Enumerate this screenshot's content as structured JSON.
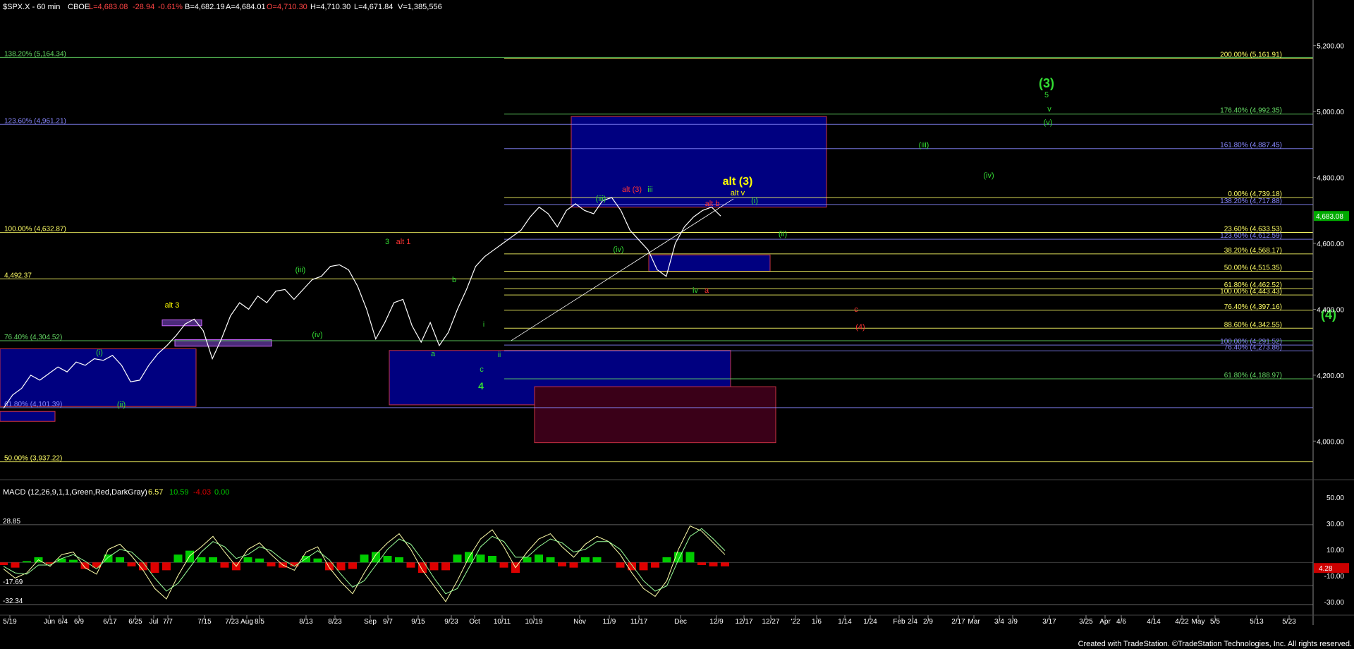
{
  "header": {
    "symbol": "$SPX.X - 60 min",
    "exchange": "CBOE",
    "last": "L=4,683.08",
    "change": "-28.94",
    "change_pct": "-0.61%",
    "bid": "B=4,682.19",
    "ask": "A=4,684.01",
    "open": "O=4,710.30",
    "high": "H=4,710.30",
    "low": "L=4,671.84",
    "volume": "V=1,385,556"
  },
  "footer": {
    "credit": "Created with TradeStation. ©TradeStation Technologies, Inc. All rights reserved."
  },
  "colors": {
    "background": "#000000",
    "grid": "#555555",
    "price": "#ffffff",
    "fib_yellow": "#ffff66",
    "fib_blue": "#8888ff",
    "fib_green": "#66dd66",
    "label_green": "#33dd33",
    "label_red": "#ff3333",
    "label_yellow": "#ffff00",
    "box_blue": "#000080",
    "box_maroon": "#3a0018",
    "macd_pos": "#00cc00",
    "macd_neg": "#dd0000"
  },
  "chart_data": [
    {
      "type": "line",
      "title": "$SPX.X - 60 min",
      "ylim": [
        3900,
        5300
      ],
      "y_ticks": [
        "5,200.00",
        "5,000.00",
        "4,800.00",
        "4,600.00",
        "4,400.00",
        "4,200.00",
        "4,000.00"
      ],
      "y_tick_values": [
        5200,
        5000,
        4800,
        4600,
        4400,
        4200,
        4000
      ],
      "last_price_label": "4,683.08",
      "last_price": 4683.08,
      "x_ticks": [
        "5/19",
        "Jun",
        "6/4",
        "6/9",
        "6/17",
        "6/25",
        "Jul",
        "7/7",
        "7/15",
        "7/23",
        "Aug",
        "8/5",
        "8/13",
        "8/23",
        "Sep",
        "9/7",
        "9/15",
        "9/23",
        "Oct",
        "10/11",
        "10/19",
        "Nov",
        "11/9",
        "11/17",
        "Dec",
        "12/9",
        "12/17",
        "12/27",
        "'22",
        "1/6",
        "1/14",
        "1/24",
        "Feb",
        "2/4",
        "2/9",
        "2/17",
        "Mar",
        "3/4",
        "3/9",
        "3/17",
        "3/25",
        "Apr",
        "4/6",
        "4/14",
        "4/22",
        "May",
        "5/5",
        "5/13",
        "5/23"
      ],
      "series": [
        {
          "values": [
            4100,
            4140,
            4160,
            4200,
            4185,
            4205,
            4225,
            4210,
            4240,
            4230,
            4250,
            4245,
            4260,
            4230,
            4180,
            4185,
            4230,
            4265,
            4290,
            4320,
            4355,
            4370,
            4335,
            4250,
            4310,
            4380,
            4420,
            4400,
            4440,
            4420,
            4455,
            4460,
            4430,
            4460,
            4490,
            4500,
            4530,
            4535,
            4520,
            4470,
            4400,
            4310,
            4360,
            4420,
            4430,
            4350,
            4300,
            4360,
            4290,
            4330,
            4400,
            4460,
            4530,
            4560,
            4580,
            4600,
            4620,
            4640,
            4680,
            4710,
            4690,
            4650,
            4700,
            4720,
            4700,
            4690,
            4730,
            4739,
            4700,
            4640,
            4610,
            4580,
            4520,
            4500,
            4600,
            4650,
            4680,
            4700,
            4710,
            4683
          ]
        }
      ],
      "fib_levels": [
        {
          "label": "138.20% (5,164.34)",
          "value": 5164.34,
          "side": "left",
          "color": "fib_green"
        },
        {
          "label": "200.00% (5,161.91)",
          "value": 5161.91,
          "side": "right",
          "color": "fib_yellow"
        },
        {
          "label": "176.40% (4,992.35)",
          "value": 4992.35,
          "side": "right",
          "color": "fib_green"
        },
        {
          "label": "123.60% (4,961.21)",
          "value": 4961.21,
          "side": "left",
          "color": "fib_blue"
        },
        {
          "label": "161.80% (4,887.45)",
          "value": 4887.45,
          "side": "right",
          "color": "fib_blue"
        },
        {
          "label": "0.00% (4,739.18)",
          "value": 4739.18,
          "side": "right",
          "color": "fib_yellow"
        },
        {
          "label": "138.20% (4,717.88)",
          "value": 4717.88,
          "side": "right",
          "color": "fib_blue"
        },
        {
          "label": "100.00% (4,632.87)",
          "value": 4632.87,
          "side": "left",
          "color": "fib_yellow"
        },
        {
          "label": "23.60% (4,633.53)",
          "value": 4633.53,
          "side": "right",
          "color": "fib_yellow"
        },
        {
          "label": "123.60% (4,612.59)",
          "value": 4612.59,
          "side": "right",
          "color": "fib_blue"
        },
        {
          "label": "38.20% (4,568.17)",
          "value": 4568.17,
          "side": "right",
          "color": "fib_yellow"
        },
        {
          "label": "50.00% (4,515.35)",
          "value": 4515.35,
          "side": "right",
          "color": "fib_yellow"
        },
        {
          "label": "4,492.37",
          "value": 4492.37,
          "side": "left",
          "color": "fib_yellow"
        },
        {
          "label": "61.80% (4,462.52)",
          "value": 4462.52,
          "side": "right",
          "color": "fib_yellow"
        },
        {
          "label": "100.00% (4,443.43)",
          "value": 4443.43,
          "side": "right",
          "color": "fib_yellow"
        },
        {
          "label": "76.40% (4,397.16)",
          "value": 4397.16,
          "side": "right",
          "color": "fib_yellow"
        },
        {
          "label": "88.60% (4,342.55)",
          "value": 4342.55,
          "side": "right",
          "color": "fib_yellow"
        },
        {
          "label": "76.40% (4,304.52)",
          "value": 4304.52,
          "side": "left",
          "color": "fib_green"
        },
        {
          "label": "100.00% (4,291.52)",
          "value": 4291.52,
          "side": "right",
          "color": "fib_blue"
        },
        {
          "label": "76.40% (4,273.86)",
          "value": 4273.86,
          "side": "right",
          "color": "fib_blue"
        },
        {
          "label": "61.80% (4,188.97)",
          "value": 4188.97,
          "side": "right",
          "color": "fib_green"
        },
        {
          "label": "61.80% (4,101.39)",
          "value": 4101.39,
          "side": "left",
          "color": "fib_blue"
        },
        {
          "label": "50.00% (3,937.22)",
          "value": 3937.22,
          "side": "left",
          "color": "fib_yellow"
        }
      ],
      "wave_labels": [
        {
          "text": "(3)",
          "color": "label_green"
        },
        {
          "text": "5",
          "color": "label_green"
        },
        {
          "text": "v",
          "color": "label_green"
        },
        {
          "text": "(v)",
          "color": "label_green"
        },
        {
          "text": "(iii)",
          "color": "label_green"
        },
        {
          "text": "(iv)",
          "color": "label_green"
        },
        {
          "text": "alt (3)",
          "color": "label_yellow"
        },
        {
          "text": "alt v",
          "color": "label_yellow"
        },
        {
          "text": "(i)",
          "color": "label_green"
        },
        {
          "text": "(ii)",
          "color": "label_green"
        },
        {
          "text": "(iii)",
          "color": "label_green"
        },
        {
          "text": "alt (3)",
          "color": "label_red"
        },
        {
          "text": "iii",
          "color": "label_green"
        },
        {
          "text": "alt b",
          "color": "label_red"
        },
        {
          "text": "(iv)",
          "color": "label_green"
        },
        {
          "text": "iv",
          "color": "label_green"
        },
        {
          "text": "a",
          "color": "label_red"
        },
        {
          "text": "c",
          "color": "label_red"
        },
        {
          "text": "(4)",
          "color": "label_red"
        },
        {
          "text": "(4)",
          "color": "label_green"
        },
        {
          "text": "3",
          "color": "label_green"
        },
        {
          "text": "alt 1",
          "color": "label_red"
        },
        {
          "text": "(iii)",
          "color": "label_green"
        },
        {
          "text": "b",
          "color": "label_green"
        },
        {
          "text": "alt 3",
          "color": "label_yellow"
        },
        {
          "text": "(iv)",
          "color": "label_green"
        },
        {
          "text": "(i)",
          "color": "label_green"
        },
        {
          "text": "(ii)",
          "color": "label_green"
        },
        {
          "text": "a",
          "color": "label_green"
        },
        {
          "text": "c",
          "color": "label_green"
        },
        {
          "text": "4",
          "color": "label_green"
        },
        {
          "text": "i",
          "color": "label_green"
        },
        {
          "text": "ii",
          "color": "label_green"
        }
      ]
    },
    {
      "type": "line",
      "title": "MACD (12,26,9,1,1,Green,Red,DarkGray)",
      "readouts": [
        "6.57",
        "10.59",
        "-4.03",
        "0.00"
      ],
      "readout_colors": [
        "#ffff66",
        "#00cc00",
        "#dd0000",
        "#00cc00"
      ],
      "y_ticks": [
        "50.00",
        "30.00",
        "10.00",
        "-10.00",
        "-30.00"
      ],
      "y_tick_values": [
        50,
        30,
        10,
        -10,
        -30
      ],
      "ylim": [
        -35,
        58
      ],
      "left_labels": [
        "28.85",
        "-17.69",
        "-32.34"
      ],
      "current_label": "4.28",
      "current_value": -4.28,
      "series": [
        {
          "name": "MACD",
          "values": [
            -5,
            -12,
            -8,
            2,
            -3,
            6,
            8,
            -4,
            -9,
            10,
            14,
            5,
            -6,
            -20,
            -28,
            -10,
            5,
            12,
            20,
            8,
            -3,
            10,
            15,
            6,
            -2,
            -6,
            8,
            12,
            -4,
            -15,
            -24,
            -8,
            6,
            15,
            22,
            10,
            -6,
            -18,
            -30,
            -14,
            4,
            18,
            25,
            12,
            -4,
            8,
            18,
            22,
            12,
            4,
            14,
            20,
            16,
            6,
            -8,
            -20,
            -26,
            -14,
            10,
            28,
            24,
            15,
            6
          ]
        },
        {
          "name": "Avg",
          "values": [
            -3,
            -8,
            -9,
            -2,
            -2,
            3,
            6,
            1,
            -5,
            4,
            10,
            8,
            0,
            -12,
            -22,
            -16,
            -4,
            8,
            16,
            12,
            3,
            6,
            12,
            9,
            2,
            -3,
            3,
            9,
            2,
            -9,
            -19,
            -14,
            -2,
            10,
            18,
            14,
            2,
            -12,
            -24,
            -20,
            -4,
            12,
            20,
            16,
            4,
            4,
            12,
            18,
            15,
            8,
            10,
            16,
            16,
            10,
            -2,
            -14,
            -22,
            -18,
            2,
            20,
            26,
            18,
            9
          ]
        }
      ]
    }
  ]
}
